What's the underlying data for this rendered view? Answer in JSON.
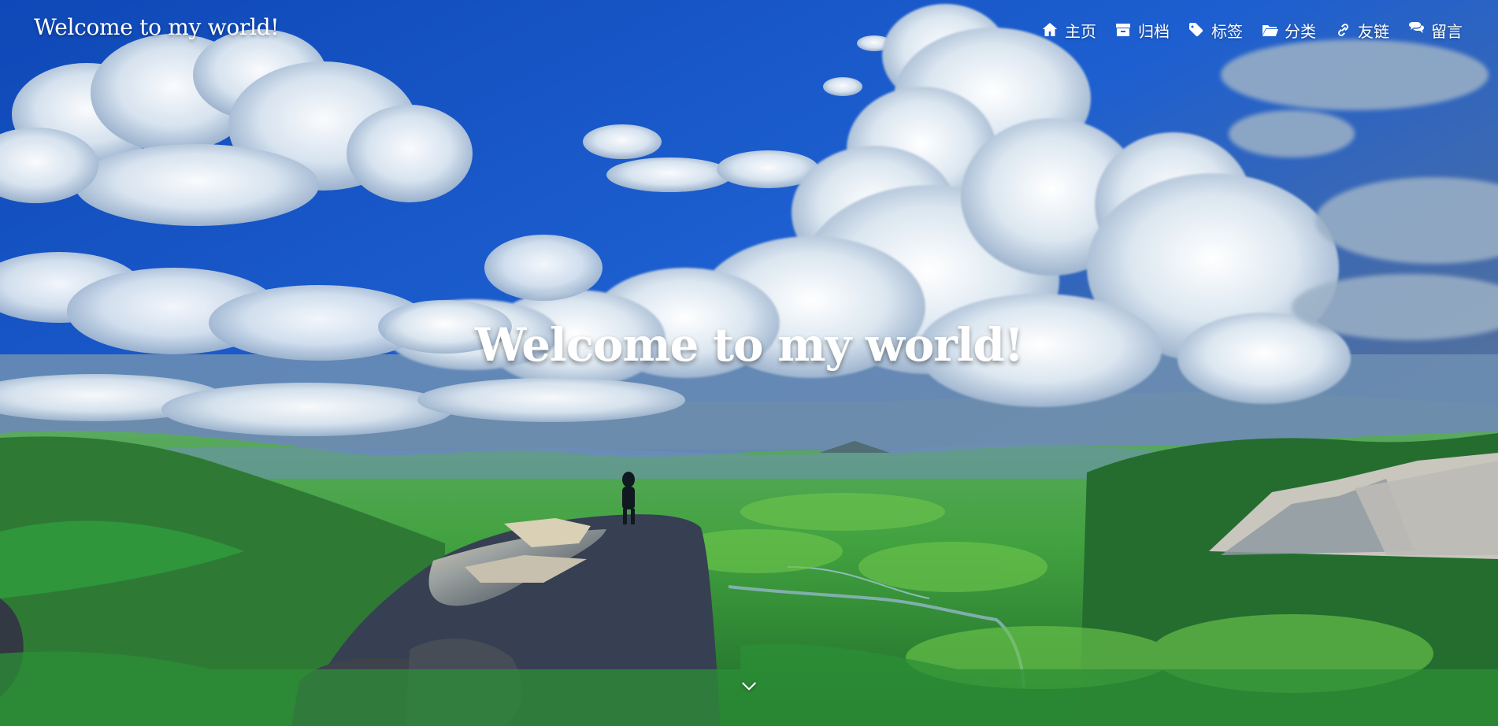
{
  "header": {
    "brand": "Welcome to my world!"
  },
  "nav": {
    "items": [
      {
        "label": "主页",
        "icon": "home-icon"
      },
      {
        "label": "归档",
        "icon": "archive-icon"
      },
      {
        "label": "标签",
        "icon": "tag-icon"
      },
      {
        "label": "分类",
        "icon": "folder-open-icon"
      },
      {
        "label": "友链",
        "icon": "link-icon"
      },
      {
        "label": "留言",
        "icon": "comments-icon"
      }
    ]
  },
  "hero": {
    "title": "Welcome to my world!",
    "scroll_icon": "chevron-down-icon"
  },
  "colors": {
    "text": "#ffffff",
    "sky": "#1b55b8",
    "grass": "#2f8f3d"
  }
}
